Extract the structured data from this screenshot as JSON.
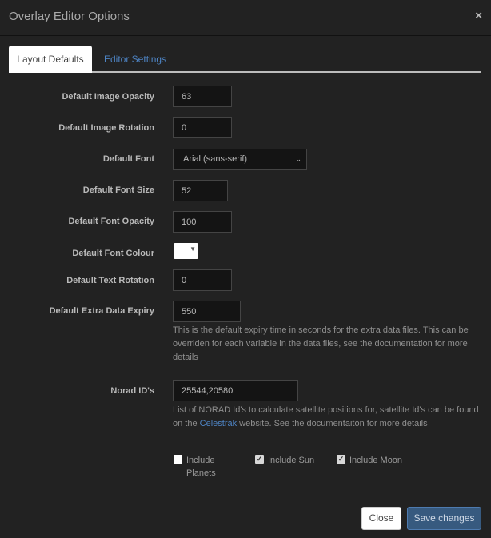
{
  "dialog": {
    "title": "Overlay Editor Options",
    "close_icon": "×"
  },
  "tabs": [
    {
      "label": "Layout Defaults",
      "active": true
    },
    {
      "label": "Editor Settings",
      "active": false
    }
  ],
  "fields": {
    "image_opacity": {
      "label": "Default Image Opacity",
      "value": "63"
    },
    "image_rotation": {
      "label": "Default Image Rotation",
      "value": "0"
    },
    "font": {
      "label": "Default Font",
      "value": "Arial (sans-serif)"
    },
    "font_size": {
      "label": "Default Font Size",
      "value": "52"
    },
    "font_opacity": {
      "label": "Default Font Opacity",
      "value": "100"
    },
    "font_colour": {
      "label": "Default Font Colour",
      "value": "#ffffff"
    },
    "text_rotation": {
      "label": "Default Text Rotation",
      "value": "0"
    },
    "extra_data_expiry": {
      "label": "Default Extra Data Expiry",
      "value": "550",
      "help": "This is the default expiry time in seconds for the extra data files. This can be overriden for each variable in the data files, see the documentation for more details"
    },
    "norad_ids": {
      "label": "Norad ID's",
      "value": "25544,20580",
      "help_before": "List of NORAD Id's to calculate satellite positions for, satellite Id's can be found on the ",
      "help_link": "Celestrak",
      "help_after": " website. See the documentaiton for more details"
    }
  },
  "checkboxes": [
    {
      "label": "Include Planets",
      "checked": false
    },
    {
      "label": "Include Sun",
      "checked": true
    },
    {
      "label": "Include Moon",
      "checked": true
    }
  ],
  "footer": {
    "close_label": "Close",
    "save_label": "Save changes"
  }
}
